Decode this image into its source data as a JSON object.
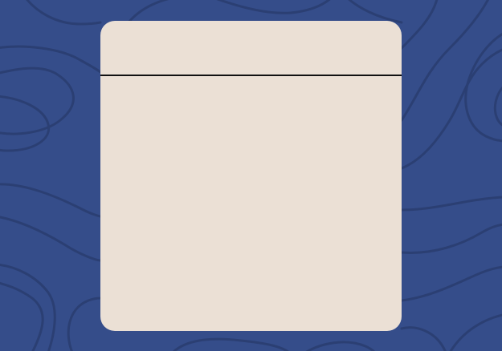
{
  "colors": {
    "background": "#354d8a",
    "contour_lines": "#2b3f73",
    "card": "#ebe0d5",
    "divider": "#111111"
  },
  "card": {
    "title": ""
  }
}
